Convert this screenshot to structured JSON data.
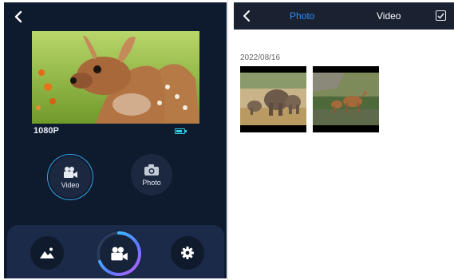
{
  "camera": {
    "resolution": "1080P",
    "modes": [
      {
        "label": "Video",
        "icon": "video-camera-icon",
        "selected": true
      },
      {
        "label": "Photo",
        "icon": "photo-camera-icon",
        "selected": false
      }
    ],
    "dock": {
      "left": "gallery-icon",
      "center": "record-video-icon",
      "right": "settings-gear-icon"
    },
    "colors": {
      "background": "#0e1a2e",
      "dock": "#1b2a48",
      "accent": "#36a6e6"
    }
  },
  "album": {
    "tabs": [
      {
        "label": "Photo",
        "active": true
      },
      {
        "label": "Video",
        "active": false
      }
    ],
    "date": "2022/08/16",
    "colors": {
      "header": "#1a2232",
      "active_tab": "#2e8cf0"
    }
  }
}
